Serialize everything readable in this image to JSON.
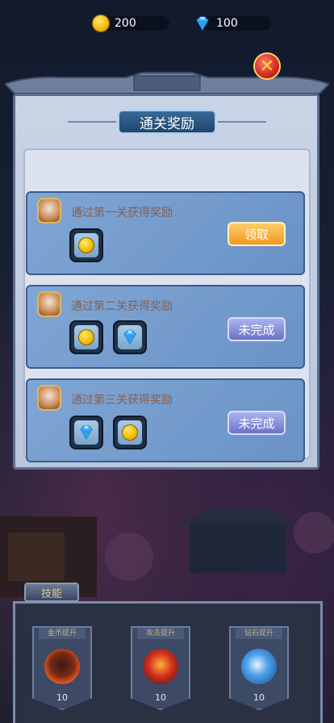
{
  "currency": {
    "coins": "200",
    "gems": "100"
  },
  "panel": {
    "title": "通关奖励"
  },
  "rewards": [
    {
      "title": "通过第一关获得奖励",
      "items": [
        "coin-icon"
      ],
      "button": "领取"
    },
    {
      "title": "通过第二关获得奖励",
      "items": [
        "coin-icon",
        "diamond-icon"
      ],
      "button": "未完成"
    },
    {
      "title": "通过第三关获得奖励",
      "items": [
        "diamond-icon",
        "coin-icon"
      ],
      "button": "未完成"
    }
  ],
  "skills": {
    "tab_label": "技能",
    "items": [
      {
        "ribbon": "金币提升",
        "level": "10"
      },
      {
        "ribbon": "攻击提升",
        "level": "10"
      },
      {
        "ribbon": "钻石提升",
        "level": "10"
      }
    ]
  },
  "colors": {
    "claim": "#f29a1e",
    "pending": "#6a72c8",
    "panel_title": "#1e456e"
  }
}
